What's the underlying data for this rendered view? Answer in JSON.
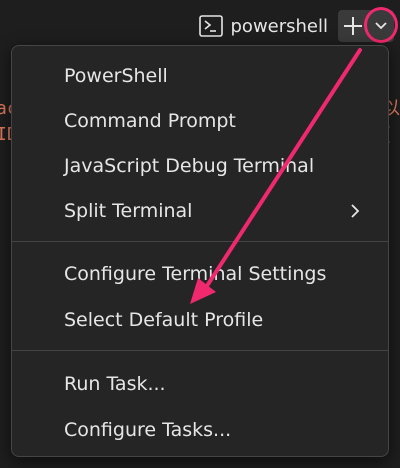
{
  "toolbar": {
    "terminal_label": "powershell",
    "terminal_icon": "terminal-prompt-icon",
    "add_icon": "plus-icon",
    "dropdown_icon": "chevron-down-icon"
  },
  "menu": {
    "items": [
      {
        "label": "PowerShell"
      },
      {
        "label": "Command Prompt"
      },
      {
        "label": "JavaScript Debug Terminal"
      },
      {
        "label": "Split Terminal",
        "submenu_icon": "chevron-right-icon"
      },
      {
        "label": "Configure Terminal Settings"
      },
      {
        "label": "Select Default Profile"
      },
      {
        "label": "Run Task..."
      },
      {
        "label": "Configure Tasks..."
      }
    ]
  },
  "background": {
    "left_fragment_line1": "ac",
    "left_fragment_line2": "ID",
    "right_fragment_line1": "以",
    "right_fragment_line2": "("
  },
  "colors": {
    "annotation": "#f0286e",
    "menu_bg": "#252526",
    "text": "#e6e6e6"
  }
}
